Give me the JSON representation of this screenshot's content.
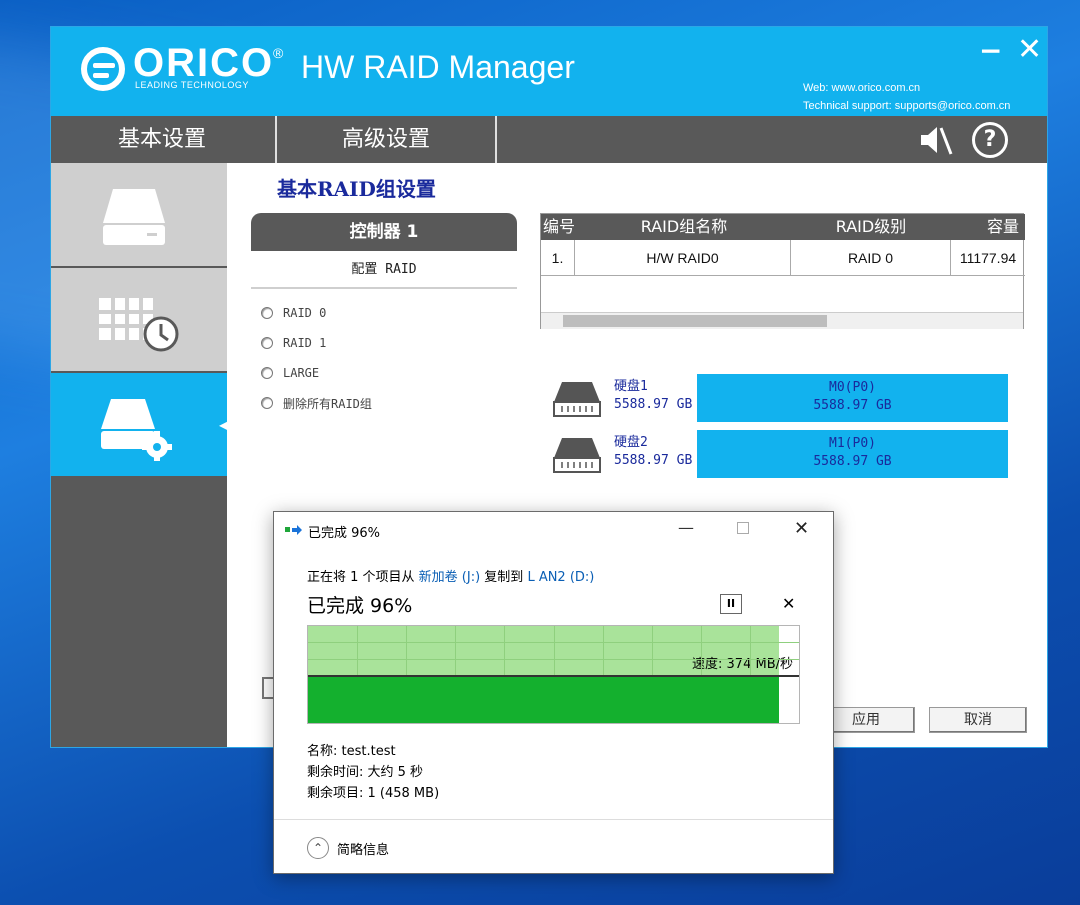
{
  "raid_window": {
    "brand": "ORICO",
    "brand_reg": "®",
    "brand_tagline": "LEADING TECHNOLOGY",
    "title": "HW RAID Manager",
    "web": "Web: www.orico.com.cn",
    "support": "Technical support: supports@orico.com.cn",
    "minimize_glyph": "−",
    "close_glyph": "✕",
    "tabs": {
      "basic": "基本设置",
      "advanced": "高级设置"
    },
    "help_glyph": "?",
    "section_title": "基本RAID组设置",
    "controller": {
      "title": "控制器 1",
      "subtitle": "配置 RAID",
      "options": [
        "RAID 0",
        "RAID 1",
        "LARGE",
        "删除所有RAID组"
      ]
    },
    "table": {
      "headers": [
        "编号",
        "RAID组名称",
        "RAID级别",
        "容量"
      ],
      "rows": [
        {
          "no": "1.",
          "name": "H/W RAID0",
          "level": "RAID 0",
          "capacity": "11177.94"
        }
      ]
    },
    "disks": [
      {
        "name": "硬盘1",
        "size": "5588.97 GB",
        "slot": "M0(P0)",
        "slot_size": "5588.97 GB"
      },
      {
        "name": "硬盘2",
        "size": "5588.97 GB",
        "slot": "M1(P0)",
        "slot_size": "5588.97 GB"
      }
    ],
    "buttons": {
      "apply": "应用",
      "cancel": "取消"
    },
    "colors": {
      "accent": "#12b2ee",
      "nav": "#595959"
    }
  },
  "copy_dialog": {
    "title": "已完成 96%",
    "minimize_glyph": "—",
    "close_glyph": "✕",
    "line1_prefix": "正在将 1 个项目从 ",
    "source": "新加卷 (J:)",
    "line1_mid": " 复制到 ",
    "dest": "L AN2 (D:)",
    "status": "已完成 96%",
    "pause_glyph": "II",
    "cancel_glyph": "✕",
    "progress_fraction": 0.96,
    "speed": "速度: 374 MB/秒",
    "name": "名称: test.test",
    "time_left": "剩余时间: 大约 5 秒",
    "items_left": "剩余项目: 1 (458 MB)",
    "more_glyph": "⌃",
    "more_info": "简略信息",
    "colors": {
      "graph_light": "#a9e39a",
      "graph_dark": "#14b02e",
      "link": "#0b5fb5"
    }
  }
}
